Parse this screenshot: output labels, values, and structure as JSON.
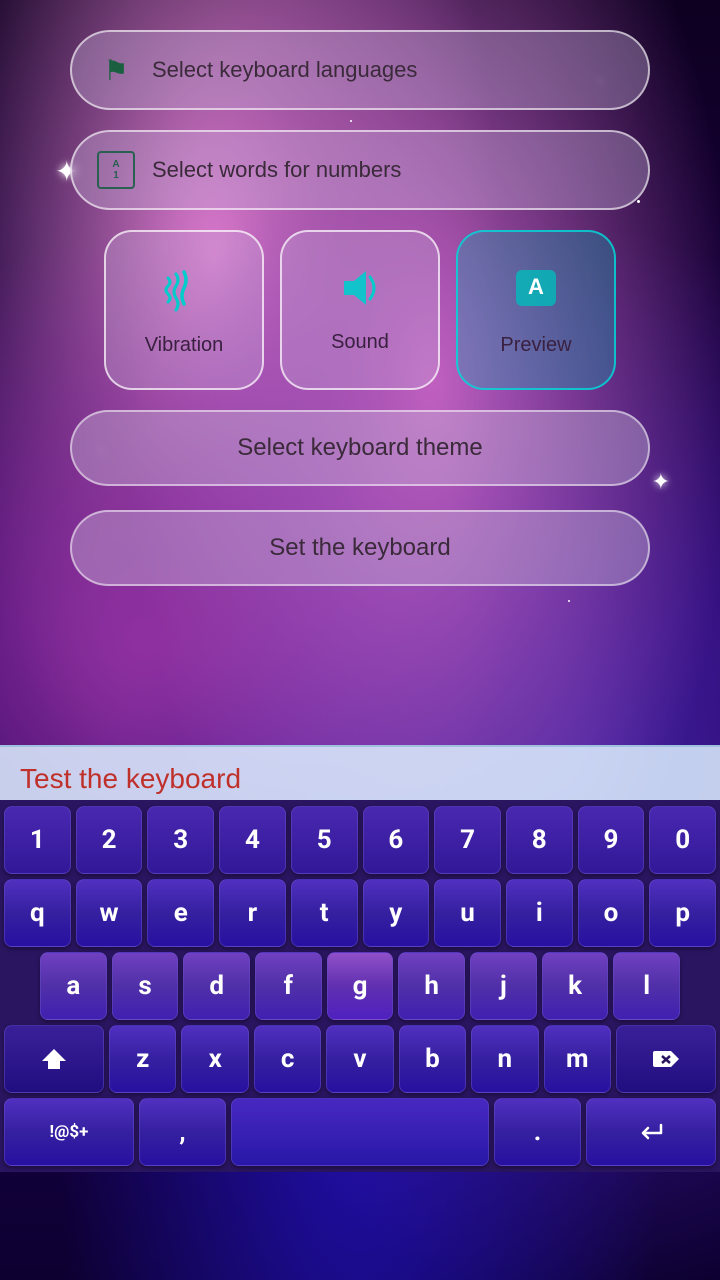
{
  "background": {
    "description": "Galaxy/nebula purple space background"
  },
  "menu": {
    "select_languages_label": "Select keyboard languages",
    "select_words_label": "Select words for numbers",
    "vibration_label": "Vibration",
    "sound_label": "Sound",
    "preview_label": "Preview",
    "select_theme_label": "Select keyboard theme",
    "set_keyboard_label": "Set the keyboard"
  },
  "test_input": {
    "placeholder": "Test the keyboard",
    "value": "Test the keyboard"
  },
  "keyboard": {
    "row_numbers": [
      "1",
      "2",
      "3",
      "4",
      "5",
      "6",
      "7",
      "8",
      "9",
      "0"
    ],
    "row_qwerty": [
      "q",
      "w",
      "e",
      "r",
      "t",
      "y",
      "u",
      "i",
      "o",
      "p"
    ],
    "row_asdf": [
      "a",
      "s",
      "d",
      "f",
      "g",
      "h",
      "j",
      "k",
      "l"
    ],
    "row_zxcv": [
      "z",
      "x",
      "c",
      "v",
      "b",
      "n",
      "m"
    ],
    "shift_label": "⇧",
    "delete_label": "⌫",
    "symbol_label": "!@$+",
    "comma_label": ",",
    "space_label": " ",
    "period_label": ".",
    "enter_label": "↵"
  },
  "icons": {
    "flag": "⚑",
    "vibration": "≋",
    "sound": "🔊",
    "preview": "A",
    "sparkle1": "✦",
    "sparkle2": "✦"
  }
}
